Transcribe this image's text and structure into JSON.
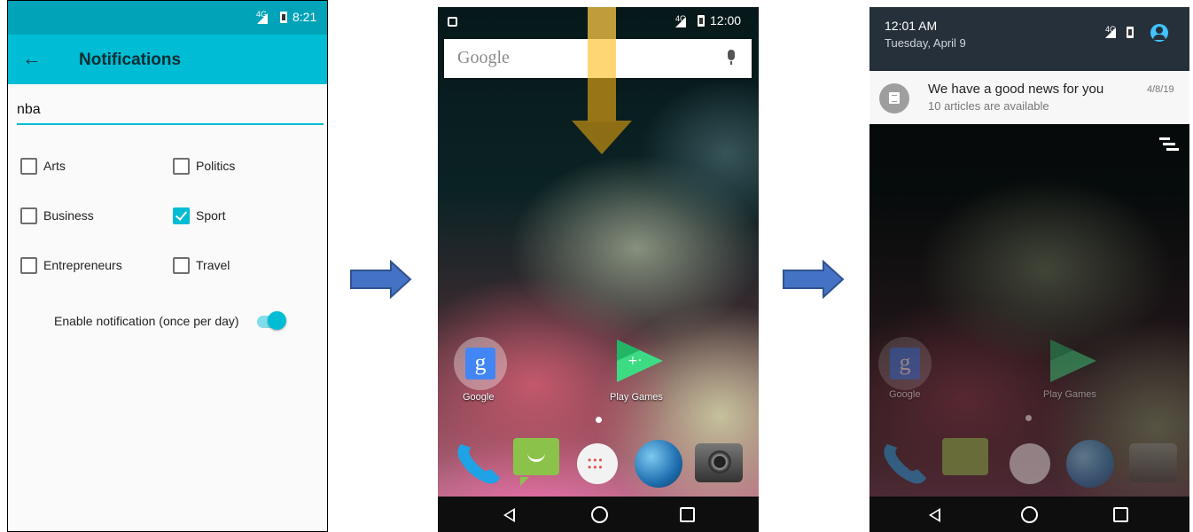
{
  "screen1": {
    "status_time": "8:21",
    "network": "4G",
    "title": "Notifications",
    "back_icon": "arrow-back-icon",
    "search_value": "nba",
    "categories": [
      {
        "label": "Arts",
        "checked": false
      },
      {
        "label": "Politics",
        "checked": false
      },
      {
        "label": "Business",
        "checked": false
      },
      {
        "label": "Sport",
        "checked": true
      },
      {
        "label": "Entrepreneurs",
        "checked": false
      },
      {
        "label": "Travel",
        "checked": false
      }
    ],
    "toggle_label": "Enable notification (once per day)",
    "toggle_on": true,
    "accent_color": "#00bcd4"
  },
  "screen2": {
    "status_time": "12:00",
    "network": "4G",
    "search_brand": "Google",
    "apps": [
      {
        "label": "Google",
        "icon": "google-search-icon"
      },
      {
        "label": "Play Games",
        "icon": "play-games-icon"
      }
    ],
    "dock": [
      "phone-icon",
      "messaging-icon",
      "app-drawer-icon",
      "browser-icon",
      "camera-icon"
    ],
    "gesture": "swipe-down-arrow"
  },
  "screen3": {
    "time": "12:01 AM",
    "date": "Tuesday, April 9",
    "network": "4G",
    "notification": {
      "title": "We have a good news for you",
      "text": "10 articles are available",
      "date": "4/8/19"
    },
    "apps": [
      {
        "label": "Google"
      },
      {
        "label": "Play Games"
      }
    ]
  },
  "flow_arrow_color": "#4472c4"
}
